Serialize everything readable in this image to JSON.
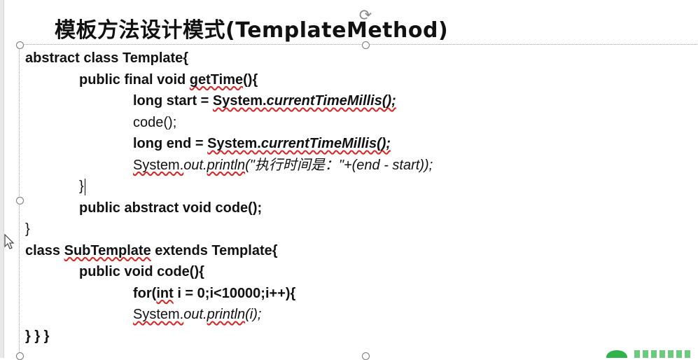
{
  "slide": {
    "title": "模板方法设计模式(TemplateMethod)"
  },
  "code_lines": [
    {
      "id": "l1",
      "segments": [
        "abstract class Template{"
      ]
    },
    {
      "id": "l2",
      "segments": [
        "public final void ",
        "getTime",
        "(){"
      ]
    },
    {
      "id": "l3",
      "segments": [
        "long start = ",
        "System.",
        "currentTimeMillis",
        "();"
      ]
    },
    {
      "id": "l4",
      "segments": [
        "code();"
      ]
    },
    {
      "id": "l5",
      "segments": [
        "long end = ",
        "System.",
        "currentTimeMillis",
        "();"
      ]
    },
    {
      "id": "l6",
      "segments": [
        "System.",
        "out.",
        "println",
        "(\"执行时间是：\"+(end - start));"
      ]
    },
    {
      "id": "l7",
      "segments": [
        "}"
      ]
    },
    {
      "id": "l8",
      "segments": [
        "public abstract void code();"
      ]
    },
    {
      "id": "l9",
      "segments": [
        "}"
      ]
    },
    {
      "id": "l10",
      "segments": [
        "class ",
        "SubTemplate",
        " extends Template{"
      ]
    },
    {
      "id": "l11",
      "segments": [
        "public void code(){"
      ]
    },
    {
      "id": "l12",
      "segments": [
        "for(",
        "int",
        " i = 0;i<10000;i++){"
      ]
    },
    {
      "id": "l13",
      "segments": [
        "System.",
        "out.",
        "println",
        "(i);"
      ]
    },
    {
      "id": "l14",
      "segments": [
        "} } }"
      ]
    }
  ],
  "icons": {
    "rotate": "rotate-handle-icon",
    "cursor": "mouse-cursor-icon",
    "logo": "watermark-logo-icon"
  },
  "colors": {
    "spellcheck_underline": "#dd2222",
    "selection_border": "#9a9a9a",
    "logo_green": "#2fb34a"
  }
}
